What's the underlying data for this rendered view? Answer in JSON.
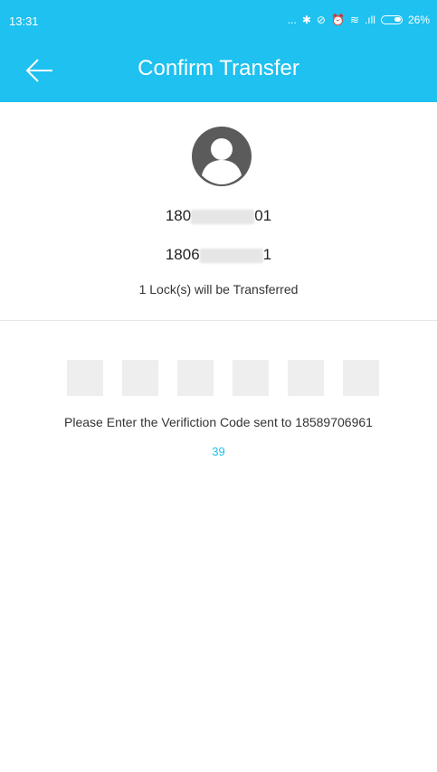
{
  "status_bar": {
    "time": "13:31",
    "dots": "...",
    "bluetooth": "✱",
    "sync": "⊘",
    "alarm": "⏰",
    "wifi": "≋",
    "signal": ".ıll",
    "battery": "26%"
  },
  "header": {
    "title": "Confirm Transfer",
    "back_icon": "arrow-left-icon",
    "background_color": "#1ec1ef"
  },
  "transfer": {
    "from_prefix": "180",
    "from_suffix": "01",
    "to_prefix": "1806",
    "to_suffix": "1",
    "note": "1 Lock(s) will be Transferred"
  },
  "verification": {
    "boxes": 6,
    "instruction": "Please Enter the Verifiction Code sent to 18589706961",
    "countdown": "39",
    "accent_color": "#1ec1ef"
  }
}
